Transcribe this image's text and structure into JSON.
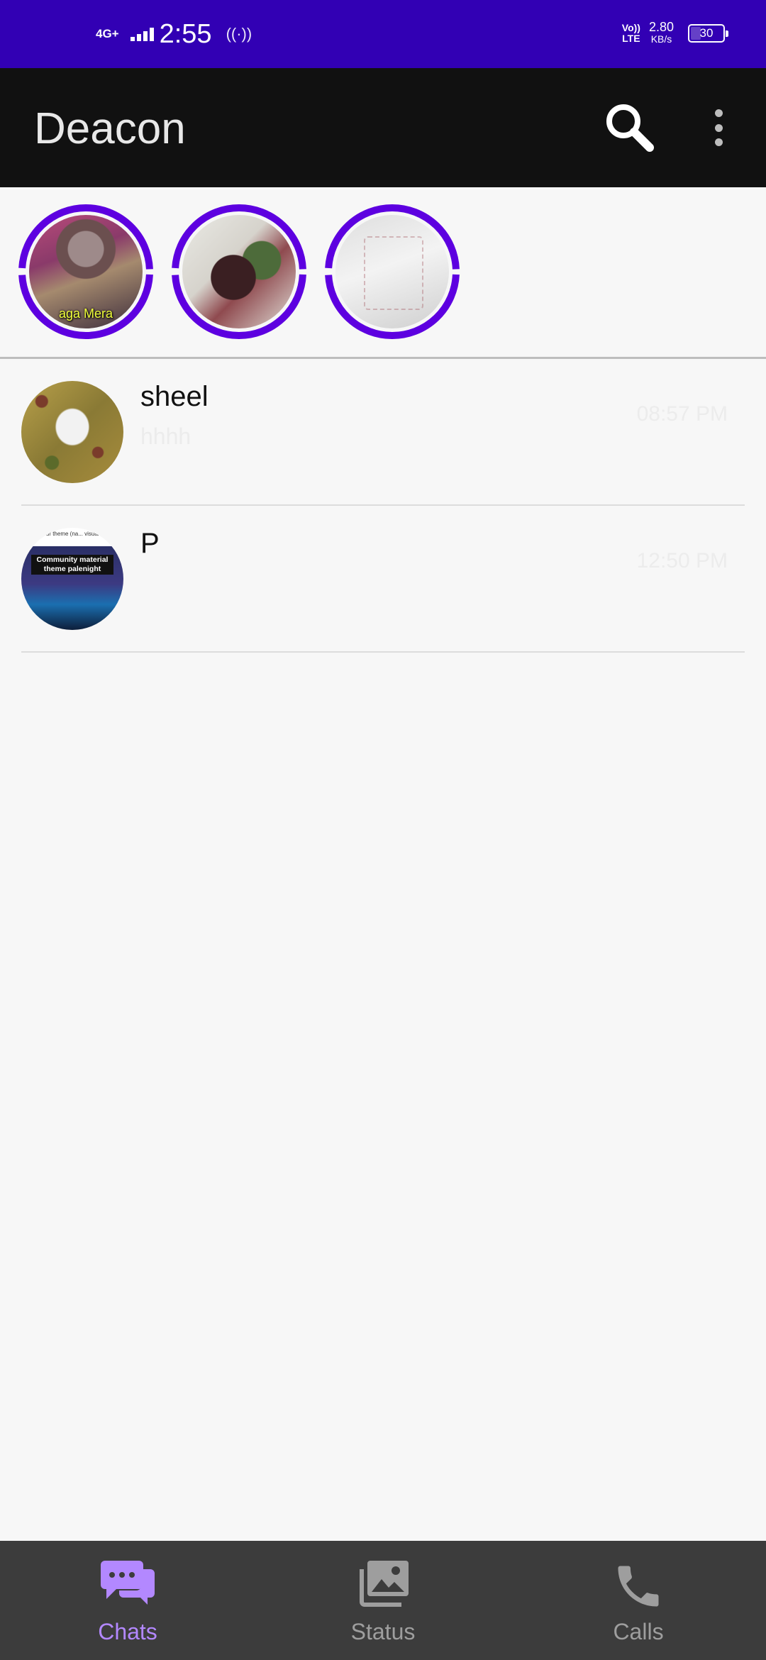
{
  "status_bar": {
    "network": "4G+",
    "time": "2:55",
    "hotspot_icon": "hotspot-icon",
    "volte": [
      "Vo))",
      "LTE"
    ],
    "speed_value": "2.80",
    "speed_unit": "KB/s",
    "battery": "30"
  },
  "app_bar": {
    "title": "Deacon",
    "search_icon": "search-icon",
    "more_icon": "more-vert-icon"
  },
  "stories": [
    {
      "name": "story-1",
      "caption": "aga Mera"
    },
    {
      "name": "story-2",
      "caption": ""
    },
    {
      "name": "story-3",
      "caption": ""
    }
  ],
  "chats": [
    {
      "name": "sheel",
      "preview": "hhhh",
      "time": "08:57 PM"
    },
    {
      "name": "P",
      "preview": "",
      "time": "12:50 PM",
      "avatar_top_text": "... e your theme (na... visual studio",
      "avatar_label": "Community material theme palenight"
    }
  ],
  "bottom_nav": {
    "items": [
      {
        "label": "Chats",
        "icon": "chat-icon",
        "active": true
      },
      {
        "label": "Status",
        "icon": "image-gallery-icon",
        "active": false
      },
      {
        "label": "Calls",
        "icon": "phone-icon",
        "active": false
      }
    ]
  },
  "colors": {
    "status_bar": "#3200b4",
    "app_bar": "#111111",
    "story_ring": "#5d00e0",
    "accent": "#b388ff",
    "bottom_nav": "#3c3c3c"
  }
}
